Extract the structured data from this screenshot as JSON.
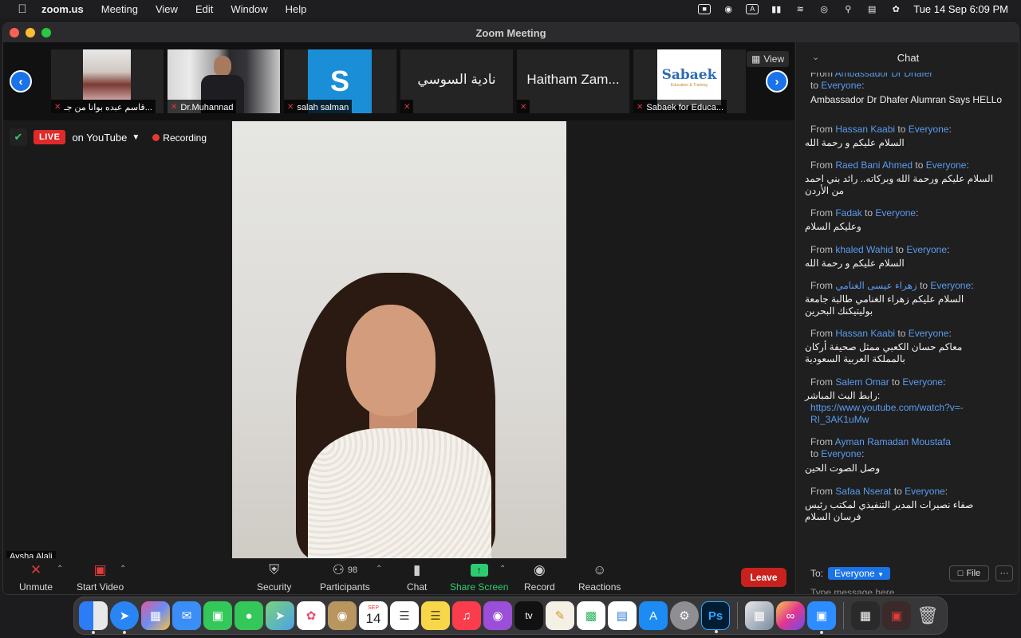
{
  "menubar": {
    "app": "zoom.us",
    "items": [
      "Meeting",
      "View",
      "Edit",
      "Window",
      "Help"
    ],
    "clock": "Tue 14 Sep  6:09 PM",
    "keyboard_badge": "A"
  },
  "window": {
    "title": "Zoom Meeting"
  },
  "strip": {
    "view_label": "View",
    "participants": [
      {
        "name": "قاسم عبده  بوانا من جـ..."
      },
      {
        "name": "Dr.Muhannad"
      },
      {
        "name": "salah salman",
        "initial": "S"
      },
      {
        "name": "",
        "display_name": "نادية السوسي"
      },
      {
        "name": "",
        "display_name": "Haitham Zam..."
      },
      {
        "name": "Sabaek for Educa...",
        "logo": "Sabaek",
        "logo_sub": "Education & Training"
      }
    ]
  },
  "live": {
    "badge": "LIVE",
    "platform": "on YouTube",
    "recording": "Recording"
  },
  "speaker": {
    "name": "Aysha Alali"
  },
  "toolbar": {
    "unmute": "Unmute",
    "start_video": "Start Video",
    "security": "Security",
    "participants": "Participants",
    "participant_count": "98",
    "chat": "Chat",
    "share_screen": "Share Screen",
    "record": "Record",
    "reactions": "Reactions",
    "leave": "Leave"
  },
  "chat": {
    "title": "Chat",
    "from_word": "From",
    "to_word": "to",
    "messages": [
      {
        "sender": "Ambassador Dr Dhafer",
        "recipient": "Everyone",
        "text": "Ambassador Dr Dhafer Alumran Says HELLo",
        "ltr": true
      },
      {
        "sender": "Hassan Kaabi",
        "recipient": "Everyone",
        "text": "السلام عليكم و رحمة الله"
      },
      {
        "sender": "Raed Bani Ahmed",
        "recipient": "Everyone",
        "text": "السلام عليكم ورحمة الله  وبركاته.. رائد بني احمد من الأردن"
      },
      {
        "sender": "Fadak",
        "recipient": "Everyone",
        "text": "وعليكم السلام"
      },
      {
        "sender": "khaled Wahid",
        "recipient": "Everyone",
        "text": "السلام عليكم و رحمة الله"
      },
      {
        "sender": "زهراء عيسى الغنامي",
        "recipient": "Everyone",
        "text": "السلام عليكم زهراء الغنامي طالبة جامعة بوليتيكنك البحرين"
      },
      {
        "sender": "Hassan Kaabi",
        "recipient": "Everyone",
        "text": "معاكم حسان الكعبي ممثل صحيفة أركان بالمملكة العربية السعودية"
      },
      {
        "sender": "Salem Omar",
        "recipient": "Everyone",
        "text": "رابط البث المباشر:",
        "link": "https://www.youtube.com/watch?v=-RI_3AK1uMw"
      },
      {
        "sender": "Ayman Ramadan Moustafa",
        "recipient": "Everyone",
        "text": "وصل الصوت الحين"
      },
      {
        "sender": "Safaa Nserat",
        "recipient": "Everyone",
        "text": "صفاء نصيرات المدير التنفيذي لمكتب رئيس فرسان السلام"
      }
    ],
    "to_label": "To:",
    "to_value": "Everyone",
    "file_label": "File",
    "more_label": "···",
    "input_placeholder": "Type message here..."
  },
  "dock": {
    "calendar_month": "SEP",
    "calendar_day": "14",
    "photoshop_label": "Ps",
    "tv_label": "tv"
  }
}
